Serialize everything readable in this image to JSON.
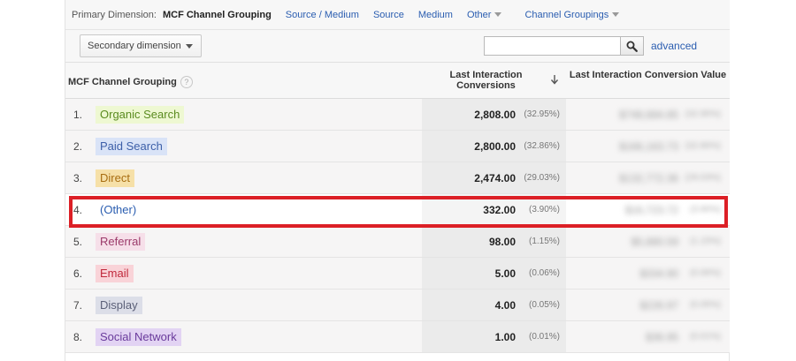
{
  "dimension_bar": {
    "label": "Primary Dimension:",
    "active": "MCF Channel Grouping",
    "links": [
      "Source / Medium",
      "Source",
      "Medium"
    ],
    "other": "Other",
    "channel_groupings": "Channel Groupings"
  },
  "toolbar": {
    "secondary_dimension": "Secondary dimension",
    "search_value": "",
    "search_placeholder": "",
    "advanced": "advanced"
  },
  "table": {
    "headers": {
      "dimension": "MCF Channel Grouping",
      "help": "?",
      "conversions": "Last Interaction Conversions",
      "value": "Last Interaction Conversion Value"
    },
    "rows": [
      {
        "num": "1.",
        "channel": "Organic Search",
        "conversions": "2,808.00",
        "percent": "(32.95%)",
        "value": "$748,684.85",
        "value_percent": "(32.95%)",
        "color": "#eef8d2",
        "text_color": "#5a8b1f"
      },
      {
        "num": "2.",
        "channel": "Paid Search",
        "conversions": "2,800.00",
        "percent": "(32.86%)",
        "value": "$166,163.73",
        "value_percent": "(32.86%)",
        "color": "#d9e3f7",
        "text_color": "#3d5fa8"
      },
      {
        "num": "3.",
        "channel": "Direct",
        "conversions": "2,474.00",
        "percent": "(29.03%)",
        "value": "$132,772.36",
        "value_percent": "(29.03%)",
        "color": "#f6e0a8",
        "text_color": "#a86d11"
      },
      {
        "num": "4.",
        "channel": "(Other)",
        "conversions": "332.00",
        "percent": "(3.90%)",
        "value": "$16,723.72",
        "value_percent": "(3.90%)",
        "color": "#ffffff",
        "text_color": "#2a5db0"
      },
      {
        "num": "5.",
        "channel": "Referral",
        "conversions": "98.00",
        "percent": "(1.15%)",
        "value": "$5,880.59",
        "value_percent": "(1.15%)",
        "color": "#f6dfe9",
        "text_color": "#9b3a6a"
      },
      {
        "num": "6.",
        "channel": "Email",
        "conversions": "5.00",
        "percent": "(0.06%)",
        "value": "$334.90",
        "value_percent": "(0.06%)",
        "color": "#f9d3d8",
        "text_color": "#c0283b"
      },
      {
        "num": "7.",
        "channel": "Display",
        "conversions": "4.00",
        "percent": "(0.05%)",
        "value": "$226.97",
        "value_percent": "(0.05%)",
        "color": "#dcdee8",
        "text_color": "#5b6078"
      },
      {
        "num": "8.",
        "channel": "Social Network",
        "conversions": "1.00",
        "percent": "(0.01%)",
        "value": "$36.95",
        "value_percent": "(0.01%)",
        "color": "#e2d3f3",
        "text_color": "#6a3b9c"
      }
    ]
  },
  "highlighted_row": 4
}
